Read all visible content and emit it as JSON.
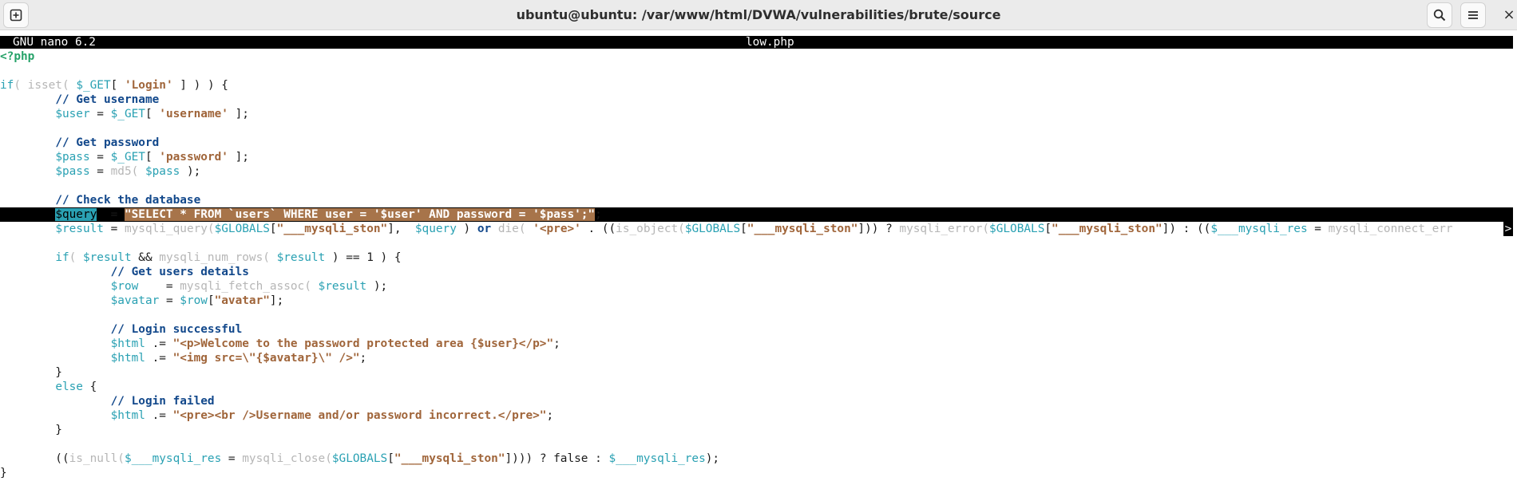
{
  "window": {
    "title": "ubuntu@ubuntu: /var/www/html/DVWA/vulnerabilities/brute/source",
    "close_glyph": "×"
  },
  "nano": {
    "version": "GNU nano 6.2",
    "filename": "low.php",
    "overflow_marker": ">"
  },
  "code_lines": [
    [
      {
        "t": "<?php",
        "c": "php"
      }
    ],
    [],
    [
      {
        "t": "if",
        "c": "kw"
      },
      {
        "t": "( isset( ",
        "c": "fn"
      },
      {
        "t": "$_GET",
        "c": "var"
      },
      {
        "t": "[ ",
        "c": "pl"
      },
      {
        "t": "'Login'",
        "c": "str"
      },
      {
        "t": " ] ) ) {",
        "c": "pl"
      }
    ],
    [
      {
        "t": "        ",
        "c": "pl"
      },
      {
        "t": "// Get username",
        "c": "cmt"
      }
    ],
    [
      {
        "t": "        ",
        "c": "pl"
      },
      {
        "t": "$user",
        "c": "var"
      },
      {
        "t": " = ",
        "c": "pl"
      },
      {
        "t": "$_GET",
        "c": "var"
      },
      {
        "t": "[ ",
        "c": "pl"
      },
      {
        "t": "'username'",
        "c": "str"
      },
      {
        "t": " ];",
        "c": "pl"
      }
    ],
    [],
    [
      {
        "t": "        ",
        "c": "pl"
      },
      {
        "t": "// Get password",
        "c": "cmt"
      }
    ],
    [
      {
        "t": "        ",
        "c": "pl"
      },
      {
        "t": "$pass",
        "c": "var"
      },
      {
        "t": " = ",
        "c": "pl"
      },
      {
        "t": "$_GET",
        "c": "var"
      },
      {
        "t": "[ ",
        "c": "pl"
      },
      {
        "t": "'password'",
        "c": "str"
      },
      {
        "t": " ];",
        "c": "pl"
      }
    ],
    [
      {
        "t": "        ",
        "c": "pl"
      },
      {
        "t": "$pass",
        "c": "var"
      },
      {
        "t": " = ",
        "c": "pl"
      },
      {
        "t": "md5( ",
        "c": "fn"
      },
      {
        "t": "$pass",
        "c": "var"
      },
      {
        "t": " );",
        "c": "pl"
      }
    ],
    [],
    [
      {
        "t": "        ",
        "c": "pl"
      },
      {
        "t": "// Check the database",
        "c": "cmt"
      }
    ],
    [
      {
        "t": "        ",
        "c": "pl"
      },
      {
        "t": "$query",
        "c": "sel-var"
      },
      {
        "t": "  = ",
        "c": "pl"
      },
      {
        "t": "\"SELECT * FROM `users` WHERE user = '$user' AND password = '$pass';\"",
        "c": "str"
      },
      {
        "t": ";",
        "c": "pl"
      }
    ],
    [
      {
        "t": "        ",
        "c": "pl"
      },
      {
        "t": "$result",
        "c": "var"
      },
      {
        "t": " = ",
        "c": "pl"
      },
      {
        "t": "mysqli_query(",
        "c": "fn"
      },
      {
        "t": "$GLOBALS",
        "c": "var"
      },
      {
        "t": "[",
        "c": "pl"
      },
      {
        "t": "\"___mysqli_ston\"",
        "c": "str"
      },
      {
        "t": "],  ",
        "c": "pl"
      },
      {
        "t": "$query",
        "c": "var"
      },
      {
        "t": " ) ",
        "c": "pl"
      },
      {
        "t": "or",
        "c": "kwb"
      },
      {
        "t": " ",
        "c": "pl"
      },
      {
        "t": "die( ",
        "c": "fn"
      },
      {
        "t": "'<pre>'",
        "c": "str"
      },
      {
        "t": " . ((",
        "c": "pl"
      },
      {
        "t": "is_object(",
        "c": "fn"
      },
      {
        "t": "$GLOBALS",
        "c": "var"
      },
      {
        "t": "[",
        "c": "pl"
      },
      {
        "t": "\"___mysqli_ston\"",
        "c": "str"
      },
      {
        "t": "])) ? ",
        "c": "pl"
      },
      {
        "t": "mysqli_error(",
        "c": "fn"
      },
      {
        "t": "$GLOBALS",
        "c": "var"
      },
      {
        "t": "[",
        "c": "pl"
      },
      {
        "t": "\"___mysqli_ston\"",
        "c": "str"
      },
      {
        "t": "]) : ((",
        "c": "pl"
      },
      {
        "t": "$___mysqli_res",
        "c": "var"
      },
      {
        "t": " = ",
        "c": "pl"
      },
      {
        "t": "mysqli_connect_err",
        "c": "fn"
      }
    ],
    [],
    [
      {
        "t": "        ",
        "c": "pl"
      },
      {
        "t": "if",
        "c": "kw"
      },
      {
        "t": "( ",
        "c": "fn"
      },
      {
        "t": "$result",
        "c": "var"
      },
      {
        "t": " && ",
        "c": "pl"
      },
      {
        "t": "mysqli_num_rows( ",
        "c": "fn"
      },
      {
        "t": "$result",
        "c": "var"
      },
      {
        "t": " ) == 1 ) {",
        "c": "pl"
      }
    ],
    [
      {
        "t": "                ",
        "c": "pl"
      },
      {
        "t": "// Get users details",
        "c": "cmt"
      }
    ],
    [
      {
        "t": "                ",
        "c": "pl"
      },
      {
        "t": "$row",
        "c": "var"
      },
      {
        "t": "    = ",
        "c": "pl"
      },
      {
        "t": "mysqli_fetch_assoc( ",
        "c": "fn"
      },
      {
        "t": "$result",
        "c": "var"
      },
      {
        "t": " );",
        "c": "pl"
      }
    ],
    [
      {
        "t": "                ",
        "c": "pl"
      },
      {
        "t": "$avatar",
        "c": "var"
      },
      {
        "t": " = ",
        "c": "pl"
      },
      {
        "t": "$row",
        "c": "var"
      },
      {
        "t": "[",
        "c": "pl"
      },
      {
        "t": "\"avatar\"",
        "c": "str"
      },
      {
        "t": "];",
        "c": "pl"
      }
    ],
    [],
    [
      {
        "t": "                ",
        "c": "pl"
      },
      {
        "t": "// Login successful",
        "c": "cmt"
      }
    ],
    [
      {
        "t": "                ",
        "c": "pl"
      },
      {
        "t": "$html",
        "c": "var"
      },
      {
        "t": " .= ",
        "c": "pl"
      },
      {
        "t": "\"<p>Welcome to the password protected area {$user}</p>\"",
        "c": "str"
      },
      {
        "t": ";",
        "c": "pl"
      }
    ],
    [
      {
        "t": "                ",
        "c": "pl"
      },
      {
        "t": "$html",
        "c": "var"
      },
      {
        "t": " .= ",
        "c": "pl"
      },
      {
        "t": "\"<img src=\\\"{$avatar}\\\" />\"",
        "c": "str"
      },
      {
        "t": ";",
        "c": "pl"
      }
    ],
    [
      {
        "t": "        }",
        "c": "pl"
      }
    ],
    [
      {
        "t": "        ",
        "c": "pl"
      },
      {
        "t": "else",
        "c": "kw"
      },
      {
        "t": " {",
        "c": "pl"
      }
    ],
    [
      {
        "t": "                ",
        "c": "pl"
      },
      {
        "t": "// Login failed",
        "c": "cmt"
      }
    ],
    [
      {
        "t": "                ",
        "c": "pl"
      },
      {
        "t": "$html",
        "c": "var"
      },
      {
        "t": " .= ",
        "c": "pl"
      },
      {
        "t": "\"<pre><br />Username and/or password incorrect.</pre>\"",
        "c": "str"
      },
      {
        "t": ";",
        "c": "pl"
      }
    ],
    [
      {
        "t": "        }",
        "c": "pl"
      }
    ],
    [],
    [
      {
        "t": "        ((",
        "c": "pl"
      },
      {
        "t": "is_null(",
        "c": "fn"
      },
      {
        "t": "$___mysqli_res",
        "c": "var"
      },
      {
        "t": " = ",
        "c": "pl"
      },
      {
        "t": "mysqli_close(",
        "c": "fn"
      },
      {
        "t": "$GLOBALS",
        "c": "var"
      },
      {
        "t": "[",
        "c": "pl"
      },
      {
        "t": "\"___mysqli_ston\"",
        "c": "str"
      },
      {
        "t": "]))) ? false : ",
        "c": "pl"
      },
      {
        "t": "$___mysqli_res",
        "c": "var"
      },
      {
        "t": ");",
        "c": "pl"
      }
    ],
    [
      {
        "t": "}",
        "c": "pl"
      }
    ]
  ],
  "selected_line_index": 11,
  "overflow_line_index": 12,
  "colors": {
    "variable": "#2aa1b3",
    "string": "#a0653a",
    "comment": "#12488b",
    "function_dim": "#b6b6b6",
    "php_tag": "#26a269",
    "header_bg": "#000000"
  }
}
